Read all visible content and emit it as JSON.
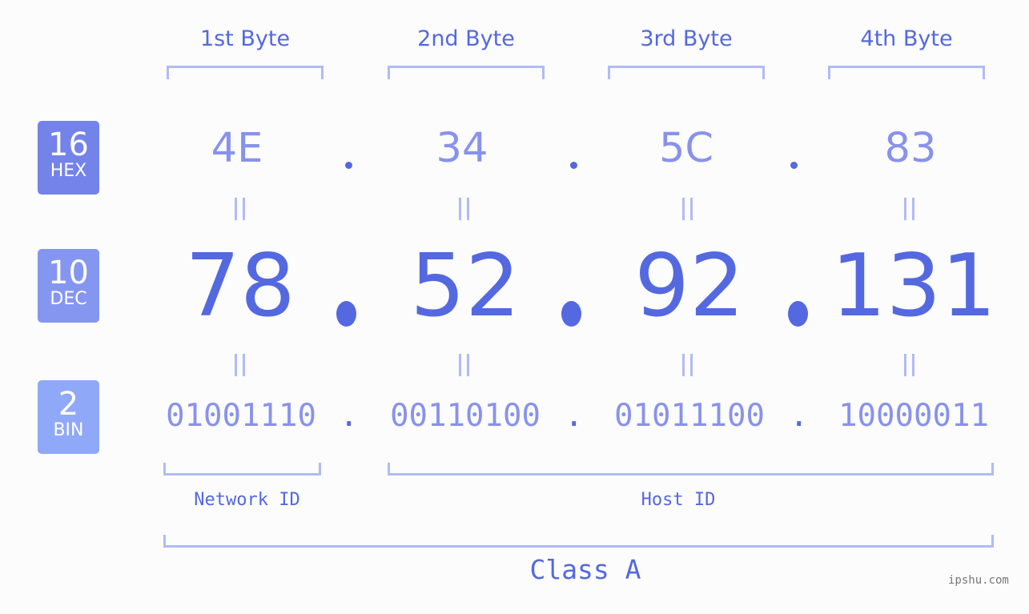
{
  "bytes": {
    "labels": [
      "1st Byte",
      "2nd Byte",
      "3rd Byte",
      "4th Byte"
    ]
  },
  "badges": {
    "hex": {
      "number": "16",
      "label": "HEX",
      "color": "#7383ea"
    },
    "dec": {
      "number": "10",
      "label": "DEC",
      "color": "#8596f0"
    },
    "bin": {
      "number": "2",
      "label": "BIN",
      "color": "#8fa8f8"
    }
  },
  "hex": [
    "4E",
    "34",
    "5C",
    "83"
  ],
  "dec": [
    "78",
    "52",
    "92",
    "131"
  ],
  "bin": [
    "01001110",
    "00110100",
    "01011100",
    "10000011"
  ],
  "separator": ".",
  "network_id_label": "Network ID",
  "host_id_label": "Host ID",
  "class_label": "Class A",
  "watermark": "ipshu.com",
  "colors": {
    "accent": "#5468e0",
    "light": "#8892ec",
    "bracket": "#b1bbf5"
  }
}
